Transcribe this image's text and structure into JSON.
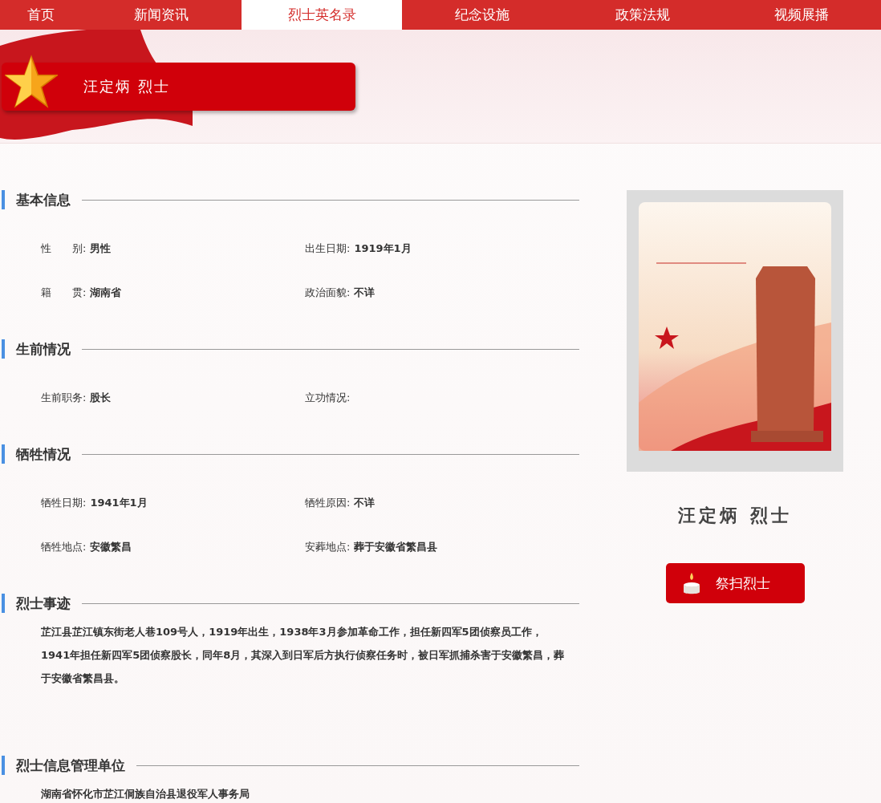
{
  "nav": {
    "tabs": [
      {
        "label": "首页",
        "selected": false
      },
      {
        "label": "新闻资讯",
        "selected": false
      },
      {
        "label": "烈士英名录",
        "selected": true
      },
      {
        "label": "纪念设施",
        "selected": false
      },
      {
        "label": "政策法规",
        "selected": false
      },
      {
        "label": "视频展播",
        "selected": false
      }
    ]
  },
  "banner": {
    "title": "汪定炳 烈士"
  },
  "sections": [
    {
      "kind": "fields",
      "title": "基本信息",
      "fields": [
        {
          "label": "性　　别:",
          "value": "男性"
        },
        {
          "label": "出生日期:",
          "value": "1919年1月"
        },
        {
          "label": "籍　　贯:",
          "value": "湖南省"
        },
        {
          "label": "政治面貌:",
          "value": "不详"
        }
      ]
    },
    {
      "kind": "fields",
      "title": "生前情况",
      "fields": [
        {
          "label": "生前职务:",
          "value": "股长"
        },
        {
          "label": "立功情况:"
        }
      ]
    },
    {
      "kind": "fields",
      "title": "牺牲情况",
      "fields": [
        {
          "label": "牺牲日期:",
          "value": "1941年1月"
        },
        {
          "label": "牺牲原因:",
          "value": "不详"
        },
        {
          "label": "牺牲地点:",
          "value": "安徽繁昌"
        },
        {
          "label": "安葬地点:",
          "value": "葬于安徽省繁昌县"
        }
      ]
    },
    {
      "kind": "text",
      "title": "烈士事迹",
      "text": "芷江县芷江镇东街老人巷109号人，1919年出生，1938年3月参加革命工作，担任新四军5团侦察员工作，1941年担任新四军5团侦察股长，同年8月，其深入到日军后方执行侦察任务时，被日军抓捕杀害于安徽繁昌，葬于安徽省繁昌县。"
    },
    {
      "kind": "text",
      "title": "烈士信息管理单位",
      "text": "湖南省怀化市芷江侗族自治县退役军人事务局"
    }
  ],
  "profile": {
    "name": "汪定炳 烈士",
    "button": "祭扫烈士"
  }
}
